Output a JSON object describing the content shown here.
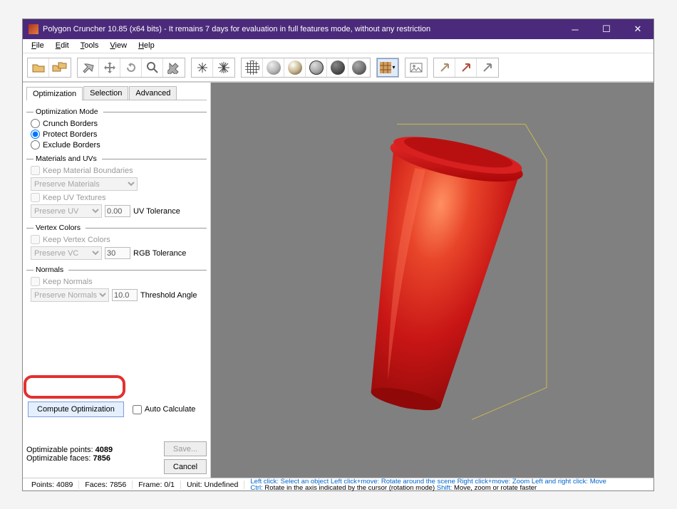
{
  "title": "Polygon Cruncher 10.85 (x64 bits) - It remains 7 days for evaluation in full features mode, without any restriction",
  "menubar": {
    "file": "File",
    "edit": "Edit",
    "tools": "Tools",
    "view": "View",
    "help": "Help"
  },
  "tabs": {
    "optimization": "Optimization",
    "selection": "Selection",
    "advanced": "Advanced"
  },
  "groups": {
    "opt_mode": "Optimization Mode",
    "materials_uvs": "Materials and UVs",
    "vertex_colors": "Vertex Colors",
    "normals": "Normals"
  },
  "radios": {
    "crunch": "Crunch Borders",
    "protect": "Protect Borders",
    "exclude": "Exclude Borders"
  },
  "checks": {
    "keep_mat_bound": "Keep Material Boundaries",
    "keep_uv": "Keep UV Textures",
    "keep_vc": "Keep Vertex Colors",
    "keep_normals": "Keep Normals",
    "auto_calc": "Auto Calculate"
  },
  "selects": {
    "preserve_materials": "Preserve Materials",
    "preserve_uv": "Preserve UV",
    "preserve_vc": "Preserve VC",
    "preserve_normals": "Preserve Normals"
  },
  "values": {
    "uv_tol": "0.00",
    "rgb_tol": "30",
    "thresh_angle": "10.0"
  },
  "labels": {
    "uv_tol": "UV Tolerance",
    "rgb_tol": "RGB Tolerance",
    "thresh_angle": "Threshold Angle",
    "compute": "Compute Optimization",
    "save": "Save...",
    "cancel": "Cancel"
  },
  "stats": {
    "opt_points_label": "Optimizable points:",
    "opt_points": "4089",
    "opt_faces_label": "Optimizable faces:",
    "opt_faces": "7856"
  },
  "status": {
    "points_label": "Points:",
    "points": "4089",
    "faces_label": "Faces:",
    "faces": "7856",
    "frame_label": "Frame:",
    "frame": "0/1",
    "unit": "Unit: Undefined",
    "hint_lc": "Left click:",
    "hint_lc_t": " Select an object ",
    "hint_lcm": "Left click+move:",
    "hint_lcm_t": " Rotate around the scene ",
    "hint_rcm": "Right click+move:",
    "hint_rcm_t": " Zoom ",
    "hint_lrc": "Left and right click:",
    "hint_lrc_t": " Move",
    "hint_ctrl": "Ctrl:",
    "hint_ctrl_t": " Rotate in the axis indicated by the cursor (rotation mode) ",
    "hint_shift": "Shift:",
    "hint_shift_t": " Move, zoom or rotate faster"
  }
}
